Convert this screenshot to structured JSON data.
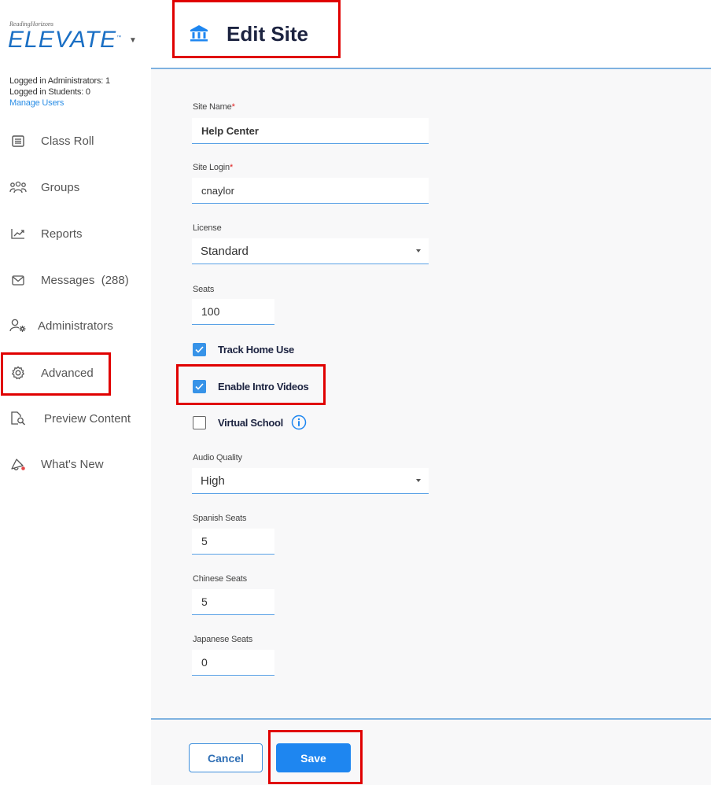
{
  "brand": {
    "small": "ReadingHorizons",
    "name": "ELEVATE",
    "tm": "™",
    "menu_icon": "chevron-down-icon"
  },
  "stats": {
    "admins": "Logged in Administrators: 1",
    "students": "Logged in Students: 0",
    "manage_users": "Manage Users"
  },
  "nav": [
    {
      "label": "Class Roll",
      "icon": "class-roll-icon"
    },
    {
      "label": "Groups",
      "icon": "groups-icon"
    },
    {
      "label": "Reports",
      "icon": "reports-icon"
    },
    {
      "label": "Messages  (288)",
      "icon": "messages-icon"
    },
    {
      "label": "Administrators",
      "icon": "administrators-icon"
    },
    {
      "label": "Advanced",
      "icon": "gear-icon"
    },
    {
      "label": "Preview Content",
      "icon": "preview-content-icon"
    },
    {
      "label": "What's New",
      "icon": "megaphone-icon"
    }
  ],
  "header": {
    "title": "Edit Site",
    "icon": "bank-icon"
  },
  "form": {
    "site_name": {
      "label": "Site Name",
      "required": "*",
      "value": "Help Center"
    },
    "site_login": {
      "label": "Site Login",
      "required": "*",
      "value": "cnaylor"
    },
    "license": {
      "label": "License",
      "value": "Standard"
    },
    "seats": {
      "label": "Seats",
      "value": "100"
    },
    "track_home_use": {
      "label": "Track Home Use",
      "checked": true
    },
    "enable_intro_videos": {
      "label": "Enable Intro Videos",
      "checked": true
    },
    "virtual_school": {
      "label": "Virtual School",
      "checked": false,
      "info_icon": "info-icon"
    },
    "audio_quality": {
      "label": "Audio Quality",
      "value": "High"
    },
    "spanish_seats": {
      "label": "Spanish Seats",
      "value": "5"
    },
    "chinese_seats": {
      "label": "Chinese Seats",
      "value": "5"
    },
    "japanese_seats": {
      "label": "Japanese Seats",
      "value": "0"
    }
  },
  "footer": {
    "cancel": "Cancel",
    "save": "Save"
  },
  "colors": {
    "accent": "#1e86f0",
    "highlight": "#e00000",
    "title": "#1c2340",
    "link": "#2b8ee6"
  }
}
